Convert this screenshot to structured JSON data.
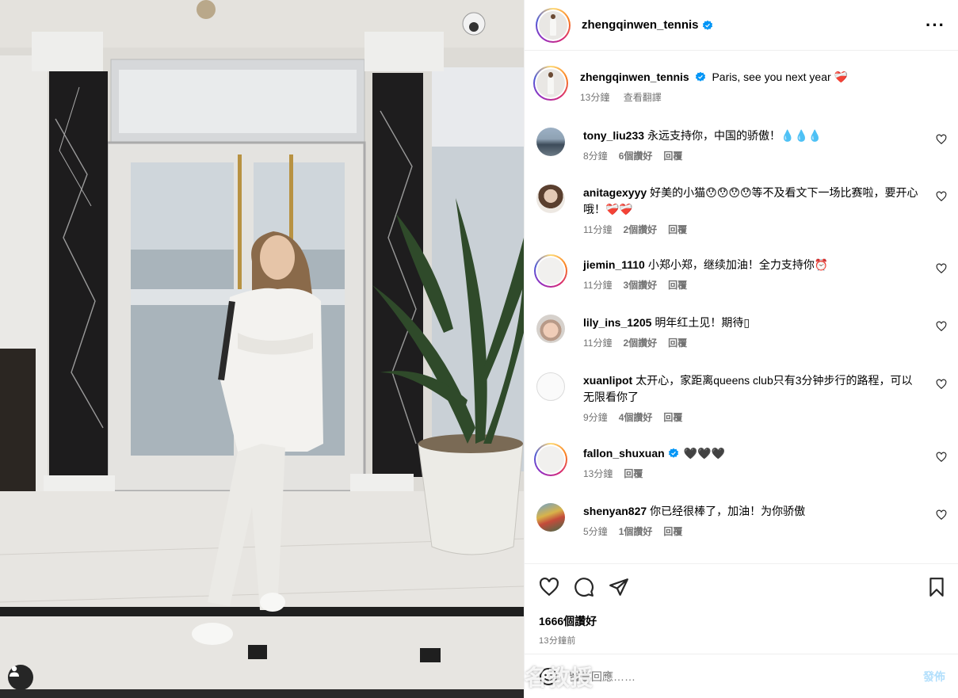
{
  "post": {
    "author": "zhengqinwen_tennis",
    "verified": true,
    "more_icon": "more-horizontal-icon"
  },
  "caption": {
    "username": "zhengqinwen_tennis",
    "text": "Paris, see you next year ❤️‍🩹",
    "time": "13分鐘",
    "translate": "查看翻譯"
  },
  "comments": [
    {
      "username": "tony_liu233",
      "text": "永远支持你，中国的骄傲！💧💧💧",
      "time": "8分鐘",
      "likes": "6個讚好",
      "reply": "回覆",
      "avatar": "landscape"
    },
    {
      "username": "anitagexyyy",
      "text": "好美的小猫😯😯😯😯等不及看文下一场比赛啦，要开心哦！❤️‍🩹❤️‍🩹",
      "time": "11分鐘",
      "likes": "2個讚好",
      "reply": "回覆",
      "avatar": "portrait"
    },
    {
      "username": "jiemin_1110",
      "text": "小郑小郑，继续加油！全力支持你⏰",
      "time": "11分鐘",
      "likes": "3個讚好",
      "reply": "回覆",
      "avatar": "ring"
    },
    {
      "username": "lily_ins_1205",
      "text": "明年红土见！期待▯",
      "time": "11分鐘",
      "likes": "2個讚好",
      "reply": "回覆",
      "avatar": "baby"
    },
    {
      "username": "xuanlipot",
      "text": "太开心，家距离queens club只有3分钟步行的路程，可以无限看你了",
      "time": "9分鐘",
      "likes": "4個讚好",
      "reply": "回覆",
      "avatar": "plain"
    },
    {
      "username": "fallon_shuxuan",
      "verified": true,
      "text": "🖤🖤🖤",
      "time": "13分鐘",
      "likes": "",
      "reply": "回覆",
      "avatar": "ring"
    },
    {
      "username": "shenyan827",
      "text": "你已经很棒了，加油！为你骄傲",
      "time": "5分鐘",
      "likes": "1個讚好",
      "reply": "回覆",
      "avatar": "colorful"
    }
  ],
  "actions": {
    "like_icon": "heart-icon",
    "comment_icon": "comment-icon",
    "share_icon": "share-icon",
    "save_icon": "bookmark-icon"
  },
  "likes_total": "1666個讚好",
  "posted_time": "13分鐘前",
  "composer": {
    "placeholder": "留言回應……",
    "post_label": "發佈"
  },
  "watermark": "名教授",
  "colors": {
    "verified": "#0095f6",
    "secondary_text": "#737373",
    "post_button_disabled": "#b2dffc"
  }
}
